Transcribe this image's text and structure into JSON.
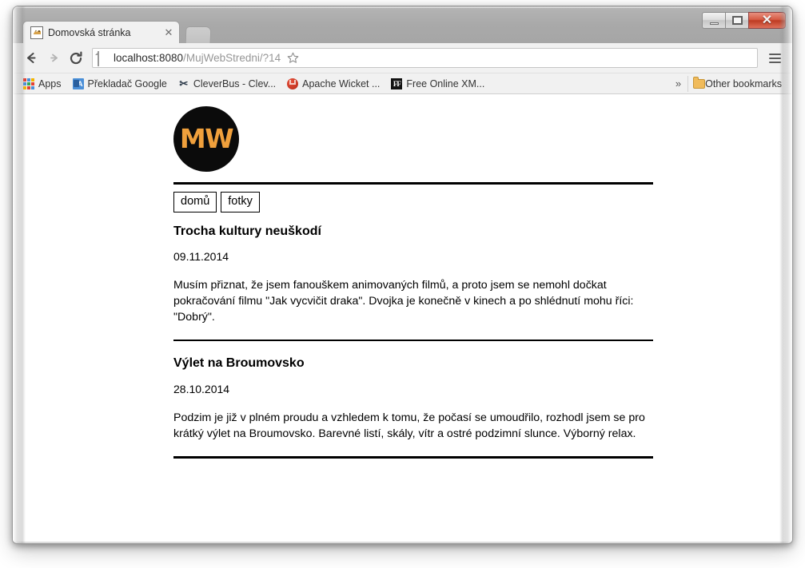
{
  "window": {
    "controls": {
      "minimize": "minimize",
      "maximize": "maximize",
      "close": "✕"
    }
  },
  "browser": {
    "tab": {
      "title": "Domovská stránka",
      "close_label": "✕"
    },
    "toolbar": {
      "back_label": "Back",
      "forward_label": "Forward",
      "reload_label": "Reload",
      "url_host": "localhost:8080",
      "url_path": "/MujWebStredni/?14",
      "url_full": "localhost:8080/MujWebStredni/?14",
      "star_label": "Bookmark this page",
      "menu_label": "Customize and control Google Chrome"
    },
    "bookmarks": [
      {
        "label": "Apps",
        "icon": "apps-grid-icon"
      },
      {
        "label": "Překladač Google",
        "icon": "google-translate-icon"
      },
      {
        "label": "CleverBus - Clev...",
        "icon": "cleverbus-icon"
      },
      {
        "label": "Apache Wicket ...",
        "icon": "apache-wicket-icon"
      },
      {
        "label": "Free Online XM...",
        "icon": "free-online-xml-icon"
      }
    ],
    "bookmarks_overflow": "»",
    "other_bookmarks": "Other bookmarks"
  },
  "page": {
    "logo_text": "MW",
    "logo_bg": "#0b0b0b",
    "logo_fg": "#f0a03c",
    "nav": [
      {
        "label": "domů"
      },
      {
        "label": "fotky"
      }
    ],
    "posts": [
      {
        "title": "Trocha kultury neuškodí",
        "date": "09.11.2014",
        "body": "Musím přiznat, že jsem fanouškem animovaných filmů, a proto jsem se nemohl dočkat pokračování filmu \"Jak vycvičit draka\". Dvojka je konečně v kinech a po shlédnutí mohu říci: \"Dobrý\"."
      },
      {
        "title": "Výlet na Broumovsko",
        "date": "28.10.2014",
        "body": "Podzim je již v plném proudu a vzhledem k tomu, že počasí se umoudřilo, rozhodl jsem se pro krátký výlet na Broumovsko. Barevné listí, skály, vítr a ostré podzimní slunce. Výborný relax."
      }
    ]
  }
}
